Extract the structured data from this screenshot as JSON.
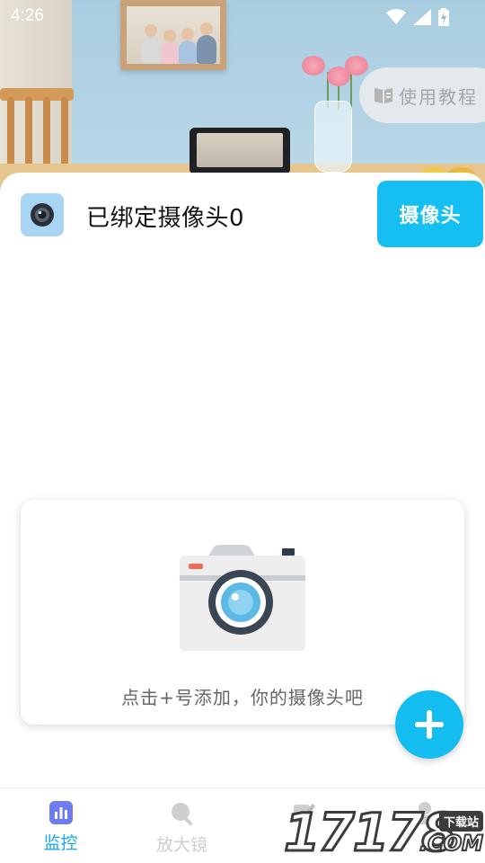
{
  "status_bar": {
    "time": "4:26",
    "icons": [
      "wifi-icon",
      "signal-icon",
      "battery-charging-icon"
    ]
  },
  "tutorial_button": {
    "icon": "book-icon",
    "label": "使用教程"
  },
  "bound_section": {
    "icon": "webcam-icon",
    "title": "已绑定摄像头0",
    "tab_label": "摄像头"
  },
  "empty_state": {
    "illustration": "camera-icon",
    "hint": "点击+号添加，你的摄像头吧"
  },
  "fab": {
    "icon": "plus-icon"
  },
  "bottom_nav": {
    "items": [
      {
        "label": "监控",
        "icon": "bar-chart-icon",
        "active": true
      },
      {
        "label": "放大镜",
        "icon": "magnifier-icon",
        "active": false
      },
      {
        "label": "",
        "icon": "edit-icon",
        "active": false
      },
      {
        "label": "",
        "icon": "profile-icon",
        "active": false
      }
    ]
  },
  "watermark": {
    "digits": "17178",
    "tag": "下载站",
    "suffix": ".COM"
  },
  "colors": {
    "accent": "#14bdf0",
    "nav_active": "#14a9e8",
    "nav_inactive": "#cfcfcf",
    "title_text": "#111111",
    "hint_text": "#666666"
  }
}
